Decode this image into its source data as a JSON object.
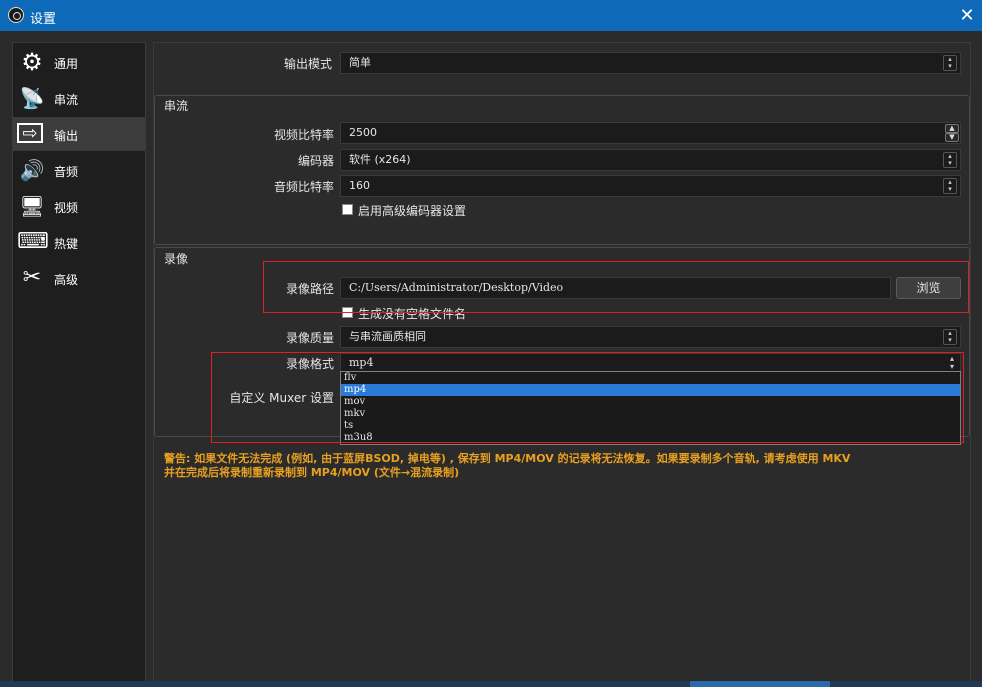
{
  "window": {
    "title": "设置",
    "close_glyph": "✕"
  },
  "sidebar": {
    "items": [
      {
        "label": "通用",
        "icon": "gear-icon",
        "glyph": "⚙"
      },
      {
        "label": "串流",
        "icon": "broadcast-icon",
        "glyph": "📡"
      },
      {
        "label": "输出",
        "icon": "output-icon",
        "glyph": "⇨"
      },
      {
        "label": "音频",
        "icon": "speaker-icon",
        "glyph": "🔊"
      },
      {
        "label": "视频",
        "icon": "monitor-icon",
        "glyph": "🖥"
      },
      {
        "label": "热键",
        "icon": "keyboard-icon",
        "glyph": "⌨"
      },
      {
        "label": "高级",
        "icon": "tools-icon",
        "glyph": "✂"
      }
    ],
    "active_index": 2
  },
  "output_mode": {
    "label": "输出模式",
    "value": "简单"
  },
  "streaming": {
    "title": "串流",
    "video_bitrate": {
      "label": "视频比特率",
      "value": "2500"
    },
    "encoder": {
      "label": "编码器",
      "value": "软件 (x264)"
    },
    "audio_bitrate": {
      "label": "音频比特率",
      "value": "160"
    },
    "advanced_encoder": {
      "label": "启用高级编码器设置",
      "checked": false
    }
  },
  "recording": {
    "title": "录像",
    "path": {
      "label": "录像路径",
      "value": "C:/Users/Administrator/Desktop/Video",
      "browse": "浏览"
    },
    "no_space_filename": {
      "label": "生成没有空格文件名",
      "checked": false
    },
    "quality": {
      "label": "录像质量",
      "value": "与串流画质相同"
    },
    "format": {
      "label": "录像格式",
      "value": "mp4",
      "options": [
        "flv",
        "mp4",
        "mov",
        "mkv",
        "ts",
        "m3u8"
      ],
      "selected": "mp4"
    },
    "muxer": {
      "label": "自定义 Muxer 设置"
    }
  },
  "warning": {
    "line1": "警告: 如果文件无法完成 (例如, 由于蓝屏BSOD, 掉电等) , 保存到 MP4/MOV 的记录将无法恢复。如果要录制多个音轨, 请考虑使用 MKV",
    "line2": "并在完成后将录制重新录制到 MP4/MOV (文件→混流录制)"
  }
}
